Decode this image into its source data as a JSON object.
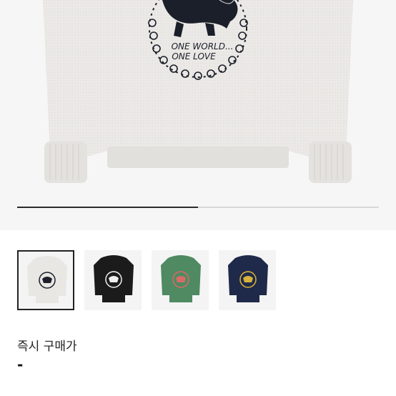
{
  "product": {
    "print_text_line1": "ONE WORLD...",
    "print_text_line2": "ONE LOVE",
    "gallery": {
      "progress_fraction": 0.5,
      "thumbnails": [
        {
          "name": "hoodie-ash",
          "color": "#e9e7e3",
          "print": "#1a1f29",
          "selected": true
        },
        {
          "name": "hoodie-black",
          "color": "#1b1b1b",
          "print": "#f0f0f0",
          "selected": false
        },
        {
          "name": "hoodie-green",
          "color": "#4f8a62",
          "print": "#d86b67",
          "selected": false
        },
        {
          "name": "hoodie-navy",
          "color": "#1f2a4a",
          "print": "#d9b23a",
          "selected": false
        }
      ]
    }
  },
  "pricing": {
    "label": "즉시 구매가",
    "value": "-"
  }
}
